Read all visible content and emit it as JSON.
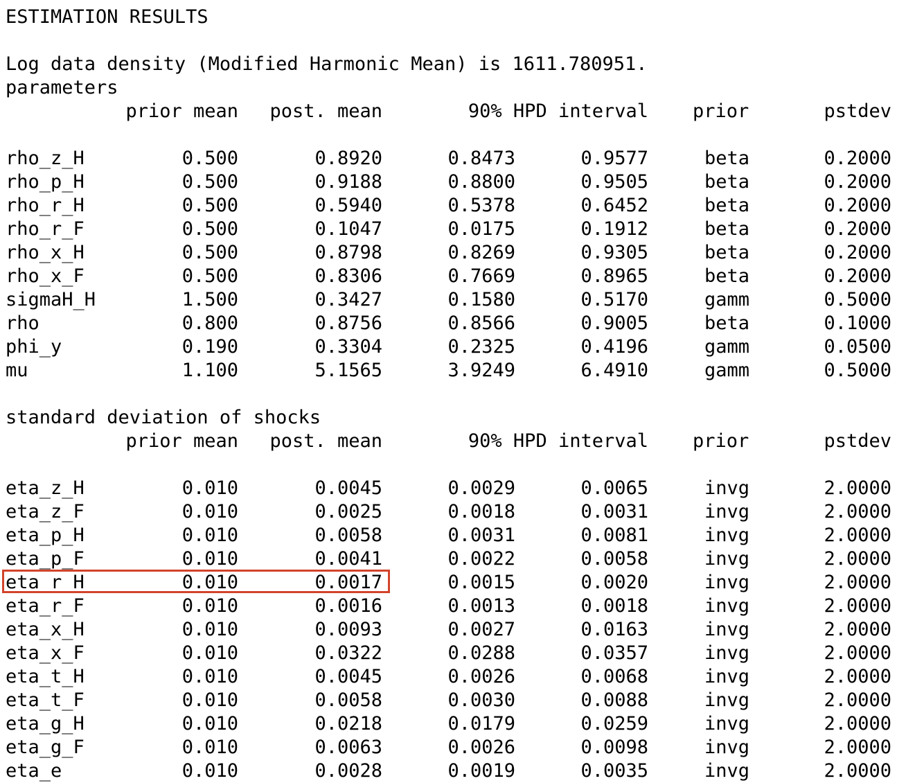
{
  "header": {
    "title": "ESTIMATION RESULTS",
    "log_density": "Log data density (Modified Harmonic Mean) is 1611.780951."
  },
  "parameters": {
    "section_label": "parameters",
    "columns": {
      "prior_mean": "prior mean",
      "post_mean": "post. mean",
      "hpd": "90% HPD interval",
      "prior": "prior",
      "pstdev": "pstdev"
    },
    "rows": [
      {
        "name": "rho_z_H",
        "prior_mean": "0.500",
        "post_mean": "0.8920",
        "hpd_lo": "0.8473",
        "hpd_hi": "0.9577",
        "prior": "beta",
        "pstdev": "0.2000"
      },
      {
        "name": "rho_p_H",
        "prior_mean": "0.500",
        "post_mean": "0.9188",
        "hpd_lo": "0.8800",
        "hpd_hi": "0.9505",
        "prior": "beta",
        "pstdev": "0.2000"
      },
      {
        "name": "rho_r_H",
        "prior_mean": "0.500",
        "post_mean": "0.5940",
        "hpd_lo": "0.5378",
        "hpd_hi": "0.6452",
        "prior": "beta",
        "pstdev": "0.2000"
      },
      {
        "name": "rho_r_F",
        "prior_mean": "0.500",
        "post_mean": "0.1047",
        "hpd_lo": "0.0175",
        "hpd_hi": "0.1912",
        "prior": "beta",
        "pstdev": "0.2000"
      },
      {
        "name": "rho_x_H",
        "prior_mean": "0.500",
        "post_mean": "0.8798",
        "hpd_lo": "0.8269",
        "hpd_hi": "0.9305",
        "prior": "beta",
        "pstdev": "0.2000"
      },
      {
        "name": "rho_x_F",
        "prior_mean": "0.500",
        "post_mean": "0.8306",
        "hpd_lo": "0.7669",
        "hpd_hi": "0.8965",
        "prior": "beta",
        "pstdev": "0.2000"
      },
      {
        "name": "sigmaH_H",
        "prior_mean": "1.500",
        "post_mean": "0.3427",
        "hpd_lo": "0.1580",
        "hpd_hi": "0.5170",
        "prior": "gamm",
        "pstdev": "0.5000"
      },
      {
        "name": "rho",
        "prior_mean": "0.800",
        "post_mean": "0.8756",
        "hpd_lo": "0.8566",
        "hpd_hi": "0.9005",
        "prior": "beta",
        "pstdev": "0.1000"
      },
      {
        "name": "phi_y",
        "prior_mean": "0.190",
        "post_mean": "0.3304",
        "hpd_lo": "0.2325",
        "hpd_hi": "0.4196",
        "prior": "gamm",
        "pstdev": "0.0500"
      },
      {
        "name": "mu",
        "prior_mean": "1.100",
        "post_mean": "5.1565",
        "hpd_lo": "3.9249",
        "hpd_hi": "6.4910",
        "prior": "gamm",
        "pstdev": "0.5000"
      }
    ]
  },
  "shocks": {
    "section_label": "standard deviation of shocks",
    "columns": {
      "prior_mean": "prior mean",
      "post_mean": "post. mean",
      "hpd": "90% HPD interval",
      "prior": "prior",
      "pstdev": "pstdev"
    },
    "rows": [
      {
        "name": "eta_z_H",
        "prior_mean": "0.010",
        "post_mean": "0.0045",
        "hpd_lo": "0.0029",
        "hpd_hi": "0.0065",
        "prior": "invg",
        "pstdev": "2.0000"
      },
      {
        "name": "eta_z_F",
        "prior_mean": "0.010",
        "post_mean": "0.0025",
        "hpd_lo": "0.0018",
        "hpd_hi": "0.0031",
        "prior": "invg",
        "pstdev": "2.0000"
      },
      {
        "name": "eta_p_H",
        "prior_mean": "0.010",
        "post_mean": "0.0058",
        "hpd_lo": "0.0031",
        "hpd_hi": "0.0081",
        "prior": "invg",
        "pstdev": "2.0000"
      },
      {
        "name": "eta_p_F",
        "prior_mean": "0.010",
        "post_mean": "0.0041",
        "hpd_lo": "0.0022",
        "hpd_hi": "0.0058",
        "prior": "invg",
        "pstdev": "2.0000"
      },
      {
        "name": "eta_r_H",
        "prior_mean": "0.010",
        "post_mean": "0.0017",
        "hpd_lo": "0.0015",
        "hpd_hi": "0.0020",
        "prior": "invg",
        "pstdev": "2.0000",
        "highlighted": true
      },
      {
        "name": "eta_r_F",
        "prior_mean": "0.010",
        "post_mean": "0.0016",
        "hpd_lo": "0.0013",
        "hpd_hi": "0.0018",
        "prior": "invg",
        "pstdev": "2.0000"
      },
      {
        "name": "eta_x_H",
        "prior_mean": "0.010",
        "post_mean": "0.0093",
        "hpd_lo": "0.0027",
        "hpd_hi": "0.0163",
        "prior": "invg",
        "pstdev": "2.0000"
      },
      {
        "name": "eta_x_F",
        "prior_mean": "0.010",
        "post_mean": "0.0322",
        "hpd_lo": "0.0288",
        "hpd_hi": "0.0357",
        "prior": "invg",
        "pstdev": "2.0000"
      },
      {
        "name": "eta_t_H",
        "prior_mean": "0.010",
        "post_mean": "0.0045",
        "hpd_lo": "0.0026",
        "hpd_hi": "0.0068",
        "prior": "invg",
        "pstdev": "2.0000"
      },
      {
        "name": "eta_t_F",
        "prior_mean": "0.010",
        "post_mean": "0.0058",
        "hpd_lo": "0.0030",
        "hpd_hi": "0.0088",
        "prior": "invg",
        "pstdev": "2.0000"
      },
      {
        "name": "eta_g_H",
        "prior_mean": "0.010",
        "post_mean": "0.0218",
        "hpd_lo": "0.0179",
        "hpd_hi": "0.0259",
        "prior": "invg",
        "pstdev": "2.0000"
      },
      {
        "name": "eta_g_F",
        "prior_mean": "0.010",
        "post_mean": "0.0063",
        "hpd_lo": "0.0026",
        "hpd_hi": "0.0098",
        "prior": "invg",
        "pstdev": "2.0000"
      },
      {
        "name": "eta_e",
        "prior_mean": "0.010",
        "post_mean": "0.0028",
        "hpd_lo": "0.0019",
        "hpd_hi": "0.0035",
        "prior": "invg",
        "pstdev": "2.0000"
      }
    ]
  },
  "highlight": {
    "color": "#d2432a"
  }
}
